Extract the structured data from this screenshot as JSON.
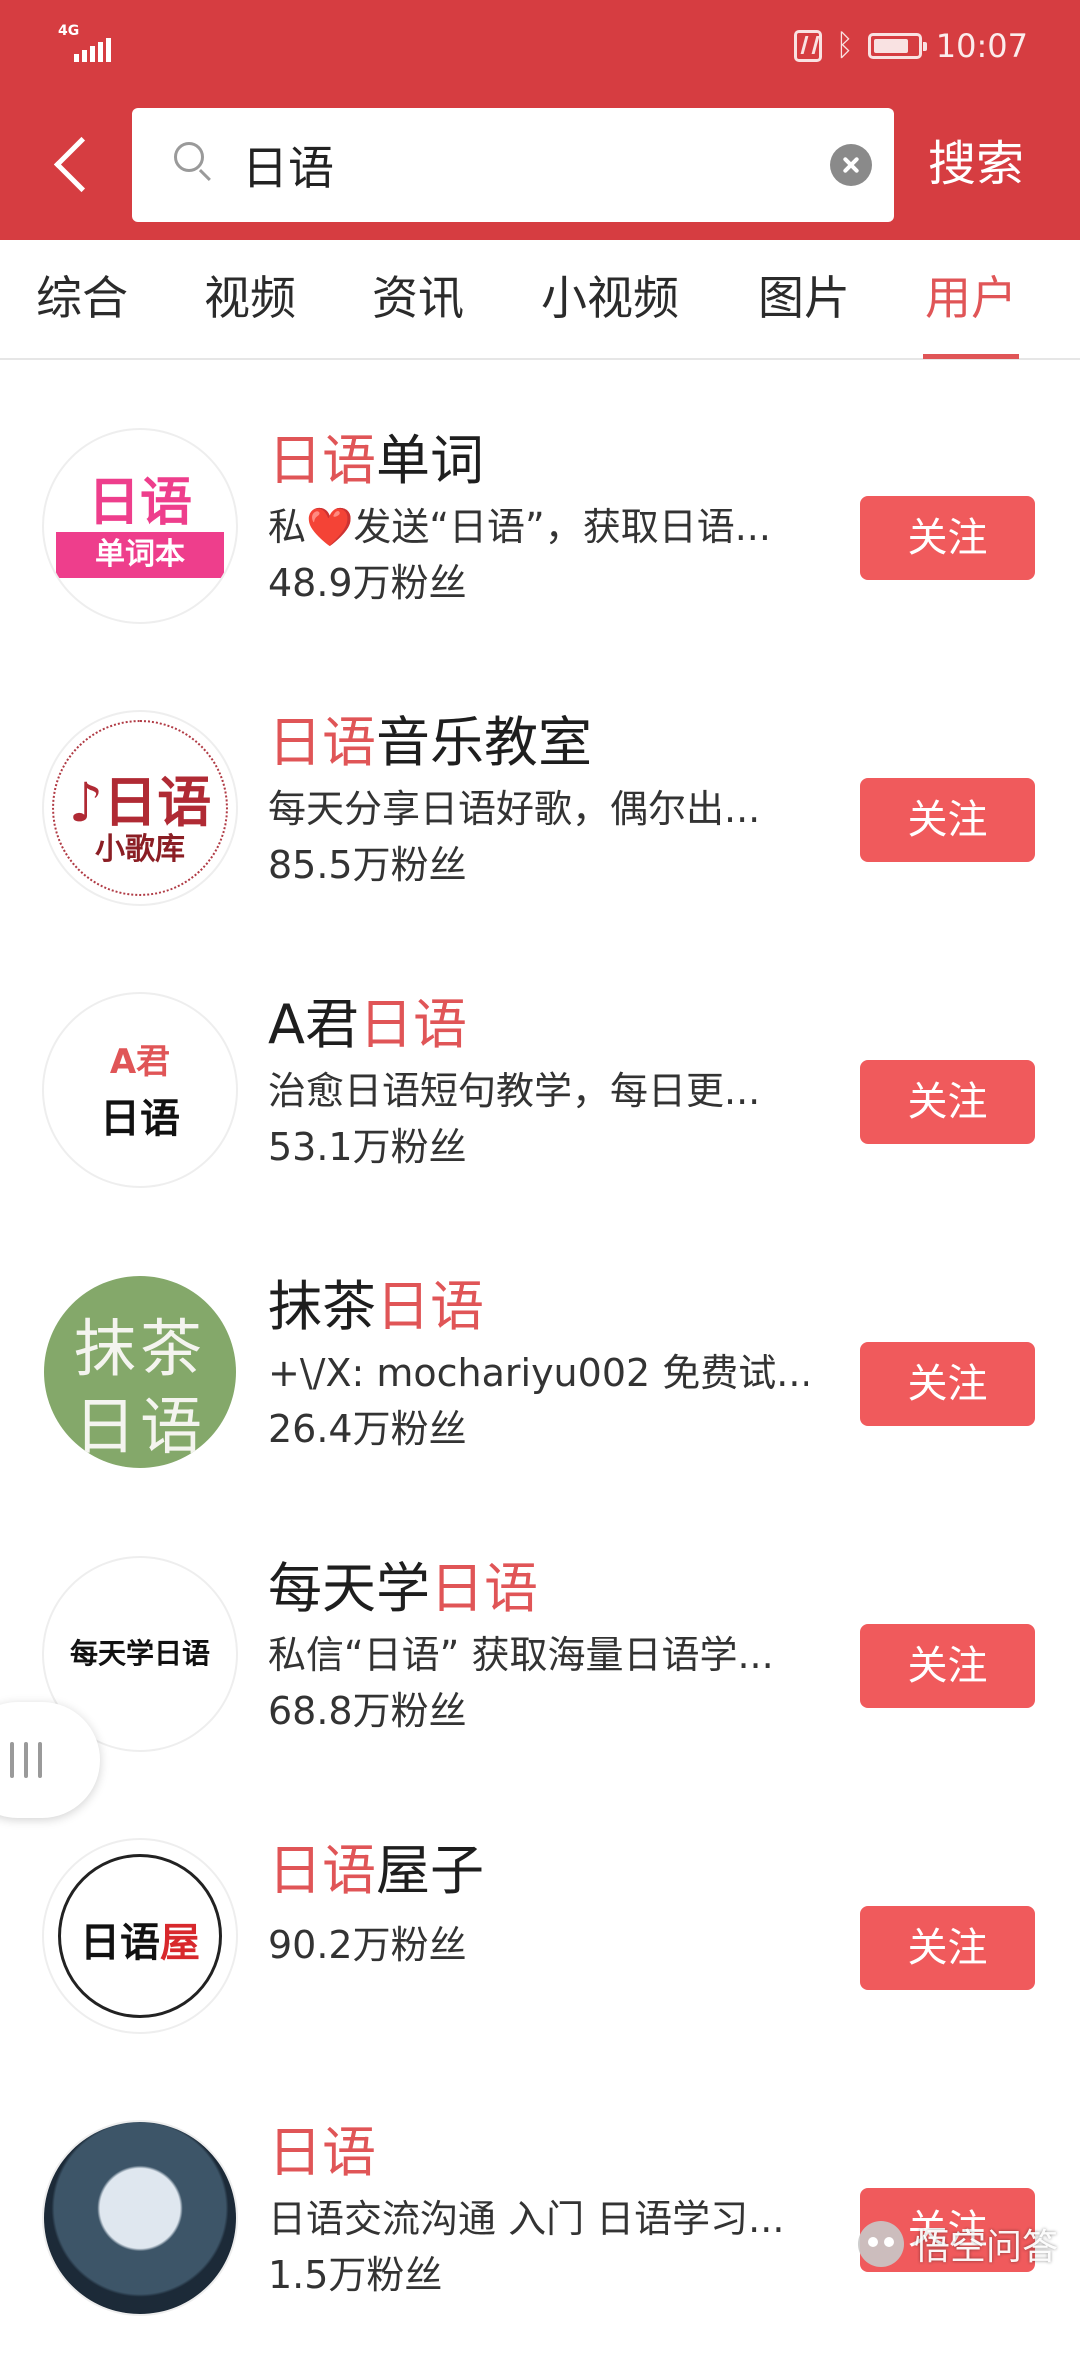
{
  "status_bar": {
    "network": "4G",
    "time": "10:07"
  },
  "header": {
    "search_value": "日语",
    "search_button": "搜索"
  },
  "tabs": [
    {
      "label": "综合",
      "active": false
    },
    {
      "label": "视频",
      "active": false
    },
    {
      "label": "资讯",
      "active": false
    },
    {
      "label": "小视频",
      "active": false
    },
    {
      "label": "图片",
      "active": false
    },
    {
      "label": "用户",
      "active": true
    }
  ],
  "users": [
    {
      "name_pre": "",
      "name_hl": "日语",
      "name_post": "单词",
      "desc": "私❤️发送“日语”，获取日语...",
      "fans": "48.9万粉丝",
      "follow": "关注",
      "avatar": {
        "line1": "日语",
        "line2": "单词本"
      }
    },
    {
      "name_pre": "",
      "name_hl": "日语",
      "name_post": "音乐教室",
      "desc": "每天分享日语好歌，偶尔出...",
      "fans": "85.5万粉丝",
      "follow": "关注",
      "avatar": {
        "line1": "♪日语",
        "line2": "小歌库"
      }
    },
    {
      "name_pre": "A君",
      "name_hl": "日语",
      "name_post": "",
      "desc": "治愈日语短句教学，每日更...",
      "fans": "53.1万粉丝",
      "follow": "关注",
      "avatar": {
        "line1": "A君",
        "line2": "日语"
      }
    },
    {
      "name_pre": "抹茶",
      "name_hl": "日语",
      "name_post": "",
      "desc": "+\\/X: mochariyu002 免费试...",
      "fans": "26.4万粉丝",
      "follow": "关注",
      "avatar": {
        "line1": "抹茶",
        "line2": "日语"
      }
    },
    {
      "name_pre": "每天学",
      "name_hl": "日语",
      "name_post": "",
      "desc": "私信“日语” 获取海量日语学...",
      "fans": "68.8万粉丝",
      "follow": "关注",
      "avatar": {
        "line1": "每天学日语"
      }
    },
    {
      "name_pre": "",
      "name_hl": "日语",
      "name_post": "屋子",
      "desc": "",
      "fans": "90.2万粉丝",
      "follow": "关注",
      "avatar": {
        "line1": "日语",
        "line1_red": "屋"
      }
    },
    {
      "name_pre": "",
      "name_hl": "日语",
      "name_post": "",
      "desc": "日语交流沟通 入门 日语学习...",
      "fans": "1.5万粉丝",
      "follow": "关注"
    }
  ],
  "watermark": "悟空问答",
  "colors": {
    "header_bg": "#d63d41",
    "accent": "#e05557",
    "follow_button": "#f05a5c"
  },
  "icons": [
    "signal-icon",
    "nfc-icon",
    "bluetooth-icon",
    "battery-icon",
    "back-icon",
    "search-icon",
    "clear-icon",
    "float-handle-icon",
    "wukong-logo-icon"
  ]
}
